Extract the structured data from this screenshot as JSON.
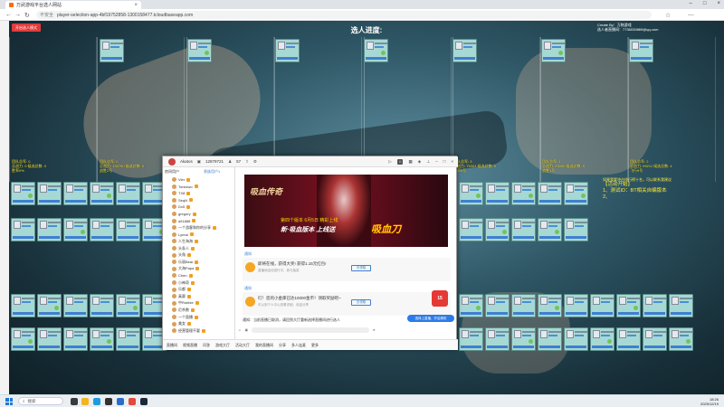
{
  "browser": {
    "tab_title": "万武游戏平台选人网站",
    "not_secure": "不安全",
    "url": "player-selection-app-4bf19752858-1300158477.tcloudbaseapp.com"
  },
  "page": {
    "red_button": "开启选人模式",
    "title": "选人进度:",
    "right_info": [
      "Create By：万物游戏",
      "选人者直播间：7736039869@qq.com"
    ],
    "team_stats": [
      {
        "line1": "团队总军: 0",
        "line2": "总战力: 0 候选总数: 0",
        "line3": "胜率0%"
      },
      {
        "line1": "团队总军: 0",
        "line2": "总战力: 130750 候选总数: 0",
        "line3": "战胜2号"
      },
      {
        "line1": "团队总军: 3",
        "line2": "总战力: 75303 候选总数: 5",
        "line3": "胜率6号"
      },
      {
        "line1": "团队总军: 1",
        "line2": "总战力: 23000 候选总数: 5",
        "line3": "战胜1号"
      },
      {
        "line1": "团队总军: 2",
        "line2": "总战力: 99211 候选总数: 4",
        "line3": "飞行9号"
      }
    ],
    "right_note": {
      "line1": "如果我要冲击排行榜十名，可以联系我建议",
      "line2": "【活动开始】",
      "line3": "1、测试ID：BT相关自编版本",
      "line4": "2、"
    }
  },
  "app": {
    "name": "Akatos",
    "id": "12879721",
    "count": "57",
    "list_header": "房间用户",
    "list_header2": "贵族用户1",
    "users": [
      "Vier",
      "Tonkzwo",
      "TX8",
      "SeqN",
      "Dx5",
      "gregory",
      "a51888",
      "一个游客和你的分享",
      "Lyreal",
      "人生海海",
      "头条人",
      "头角",
      "乐丽Bear",
      "大海Papa",
      "Chen",
      "小神奇",
      "乐都",
      "真赛",
      "中Robbie",
      "尼杀数",
      "一个直播",
      "美女",
      "经营管理不要"
    ],
    "banner": {
      "t1": "吸血传奇",
      "t4": "第四个版本 6月5日 精彩上线",
      "t3": "新·吸血版本 上线送",
      "t2": "吸血刀"
    },
    "messages": [
      {
        "name": "通知",
        "text": "即将在线，获得大奖! 获得1.15元红包!",
        "sub": "直播间活动进行中，参与抽奖",
        "btn": "去领取"
      },
      {
        "name": "通知",
        "text": "叮！您的小金库已达10000金币！领取奖励吧~",
        "sub": "可以到个人中心查看详细，欢迎分享",
        "btn": "去领取"
      }
    ],
    "badge": "15",
    "notice": "通知：当前直播已取消，请回到大厅重新选择直播间进行选人",
    "blue_button": "选择上直播，开启精彩",
    "bottom": [
      "直播间",
      "视频直播",
      "问答",
      "游戏大厅",
      "活动大厅",
      "我的直播间",
      "分享",
      "多人连麦",
      "更多"
    ]
  },
  "taskbar": {
    "search": "搜索",
    "time": "18:26",
    "date": "2025/12/19"
  }
}
